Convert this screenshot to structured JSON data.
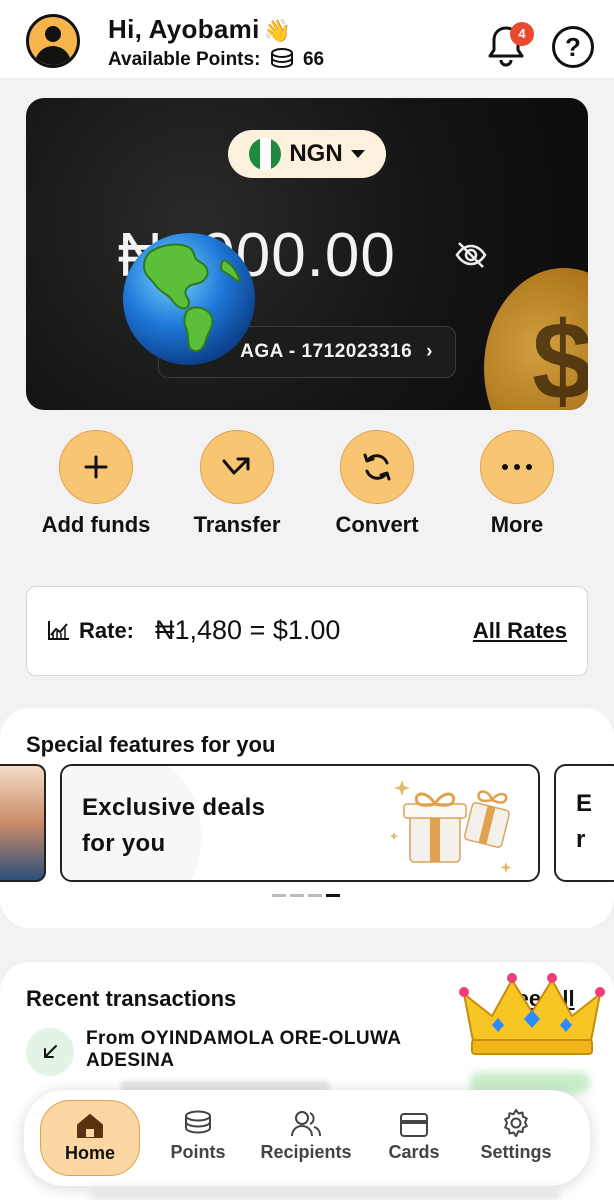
{
  "header": {
    "greeting": "Hi, Ayobami",
    "wave_glyph": "👋",
    "points_label": "Available Points:",
    "points_value": "66",
    "notification_count": "4",
    "help_glyph": "?"
  },
  "balance_card": {
    "currency_code": "NGN",
    "balance": "₦1,000.00",
    "balance_visible_portion": "₦ ,000.00",
    "account_label": "AGA - 1712023316",
    "account_chevron": "›",
    "coin_glyph": "$"
  },
  "actions": [
    {
      "label": "Add funds",
      "icon": "plus-icon"
    },
    {
      "label": "Transfer",
      "icon": "arrow-up-right-icon"
    },
    {
      "label": "Convert",
      "icon": "refresh-icon"
    },
    {
      "label": "More",
      "icon": "ellipsis-icon"
    }
  ],
  "rate": {
    "label": "Rate:",
    "value": "₦1,480 = $1.00",
    "all_rates_label": "All Rates"
  },
  "special_features": {
    "title": "Special features for you",
    "deal_line1": "Exclusive deals",
    "deal_line2": "for you",
    "next_card_peek_line1": "E",
    "next_card_peek_line2": "r"
  },
  "recent": {
    "title": "Recent transactions",
    "see_all_label": "See All",
    "transactions": [
      {
        "name_line1": "From OYINDAMOLA ORE-OLUWA",
        "name_line2": "ADESINA"
      }
    ]
  },
  "nav": [
    {
      "label": "Home",
      "icon": "home-icon",
      "active": true
    },
    {
      "label": "Points",
      "icon": "coins-icon",
      "active": false
    },
    {
      "label": "Recipients",
      "icon": "users-icon",
      "active": false
    },
    {
      "label": "Cards",
      "icon": "card-icon",
      "active": false
    },
    {
      "label": "Settings",
      "icon": "gear-icon",
      "active": false
    }
  ],
  "colors": {
    "accent": "#f8c572",
    "card_bg": "#141414",
    "badge": "#e84a2e",
    "nigeria_green": "#1f8a3d"
  }
}
